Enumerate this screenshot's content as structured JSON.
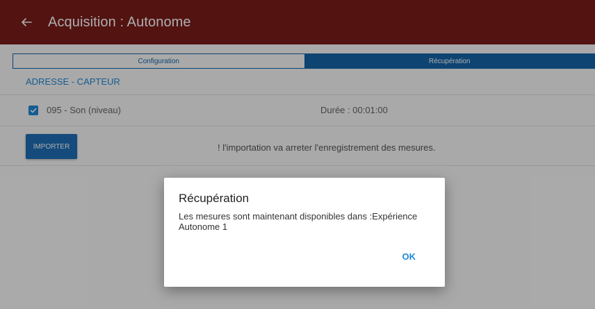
{
  "appbar": {
    "title": "Acquisition : Autonome",
    "back_icon": "arrow-left-icon"
  },
  "tabs": [
    {
      "label": "Configuration",
      "active": false
    },
    {
      "label": "Récupération",
      "active": true
    }
  ],
  "section_title": "ADRESSE - CAPTEUR",
  "sensor": {
    "label": "095 - Son (niveau)",
    "checked": true,
    "duration": "Durée : 00:01:00"
  },
  "import": {
    "button_label": "IMPORTER",
    "warning": "! l'importation va arreter l'enregistrement des mesures."
  },
  "dialog": {
    "title": "Récupération",
    "message": "Les mesures sont maintenant disponibles dans :Expérience Autonome 1",
    "ok_label": "OK"
  },
  "colors": {
    "appbar": "#7a1c1a",
    "primary": "#1565a8",
    "accent": "#1e88d8"
  }
}
